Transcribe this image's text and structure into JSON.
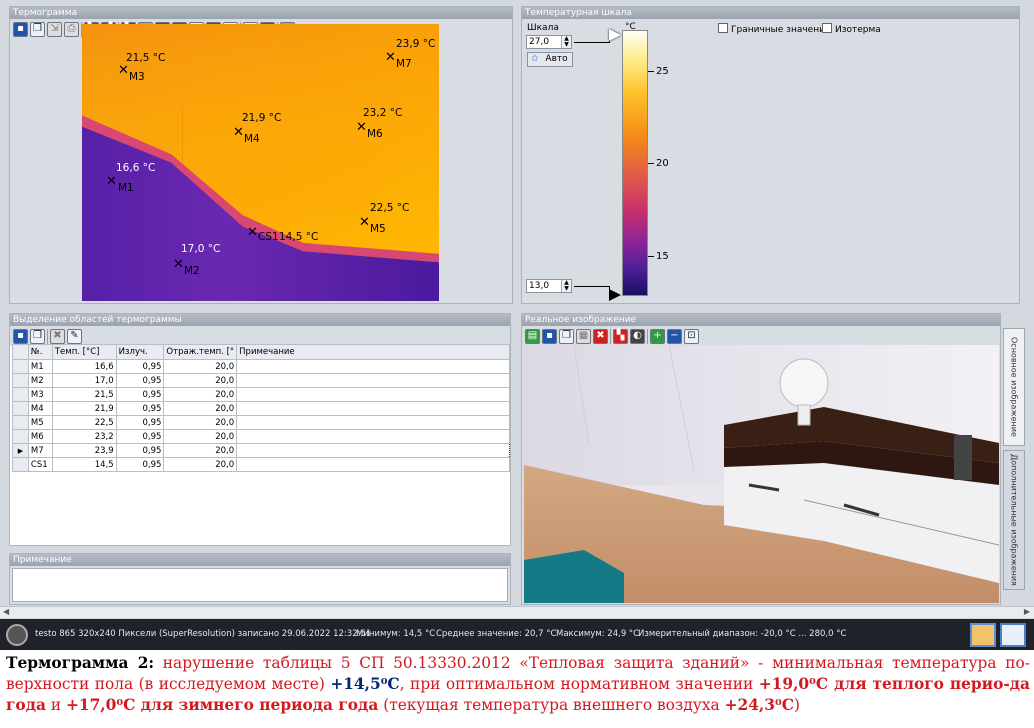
{
  "panels": {
    "thermogram": "Термограмма",
    "temp_scale": "Температурная шкала",
    "regions": "Выделение областей термограммы",
    "note": "Примечание",
    "real_image": "Реальное изображение"
  },
  "tabs": {
    "main": "Основное изображение",
    "extra": "Дополнительные изображения"
  },
  "toolbar_icons": {
    "thermogram": [
      "save-icon",
      "copy-icon",
      "export-icon",
      "print-icon",
      "palette-icon",
      "palette2-icon",
      "marker-icon",
      "hotspot-icon",
      "coldspot-icon",
      "point-icon",
      "delta-icon",
      "level-icon",
      "histogram-icon",
      "selection-icon",
      "delete-icon",
      "grid-icon"
    ],
    "regions": [
      "save-icon",
      "copy-icon",
      "delete-icon",
      "tool-icon"
    ],
    "real": [
      "open-icon",
      "save-icon",
      "copy-icon",
      "grid-icon",
      "delete-icon",
      "palette-icon",
      "contrast-icon",
      "zoom-in-icon",
      "zoom-out-icon",
      "zoom-fit-icon"
    ]
  },
  "markers": [
    {
      "id": "M3",
      "temp": "21,5 °C"
    },
    {
      "id": "M7",
      "temp": "23,9 °C"
    },
    {
      "id": "M4",
      "temp": "21,9 °C"
    },
    {
      "id": "M6",
      "temp": "23,2 °C"
    },
    {
      "id": "M1",
      "temp": "16,6 °C"
    },
    {
      "id": "M5",
      "temp": "22,5 °C"
    },
    {
      "id": "CS1",
      "temp": "14,5 °C"
    },
    {
      "id": "M2",
      "temp": "17,0 °C"
    }
  ],
  "scale": {
    "label": "Шкала",
    "unit": "°C",
    "max": "27,0",
    "min": "13,0",
    "auto_button": "Авто",
    "ticks": [
      "25",
      "20",
      "15"
    ],
    "boundary_checkbox": "Граничные значения",
    "isotherm_checkbox": "Изотерма"
  },
  "table": {
    "headers": [
      "№.",
      "Темп. [°C]",
      "Излуч.",
      "Отраж.темп. [°",
      "Примечание"
    ],
    "rows": [
      [
        "M1",
        "16,6",
        "0,95",
        "20,0",
        ""
      ],
      [
        "M2",
        "17,0",
        "0,95",
        "20,0",
        ""
      ],
      [
        "M3",
        "21,5",
        "0,95",
        "20,0",
        ""
      ],
      [
        "M4",
        "21,9",
        "0,95",
        "20,0",
        ""
      ],
      [
        "M5",
        "22,5",
        "0,95",
        "20,0",
        ""
      ],
      [
        "M6",
        "23,2",
        "0,95",
        "20,0",
        ""
      ],
      [
        "M7",
        "23,9",
        "0,95",
        "20,0",
        ""
      ],
      [
        "CS1",
        "14,5",
        "0,95",
        "20,0",
        ""
      ]
    ],
    "selected_row": 6
  },
  "status": {
    "device": "testo 865 320x240 Пиксели (SuperResolution) записано 29.06.2022 12:32:51",
    "min": "Минимум: 14,5 °C",
    "avg": "Среднее значение: 20,7 °C",
    "max": "Максимум: 24,9 °C",
    "range": "Измерительный диапазон: -20,0 °C ... 280,0 °C"
  },
  "caption": {
    "lead": "Термограмма 2:",
    "p1": " нарушение таблицы 5 СП 50.13330.2012 «Тепловая защита зданий» - минимальная температура по-верхности пола (в исследуемом месте) ",
    "v1": "+14,5⁰С",
    "p2": ", при оптимальном нормативном значении ",
    "v2": "+19,0⁰С",
    "b1": " для теплого перио-да года",
    "p3": " и ",
    "v3": "+17,0⁰С",
    "b2": " для зимнего периода года",
    "p4": " (текущая температура внешнего воздуха ",
    "v4": "+24,3⁰С",
    "p5": ")"
  }
}
